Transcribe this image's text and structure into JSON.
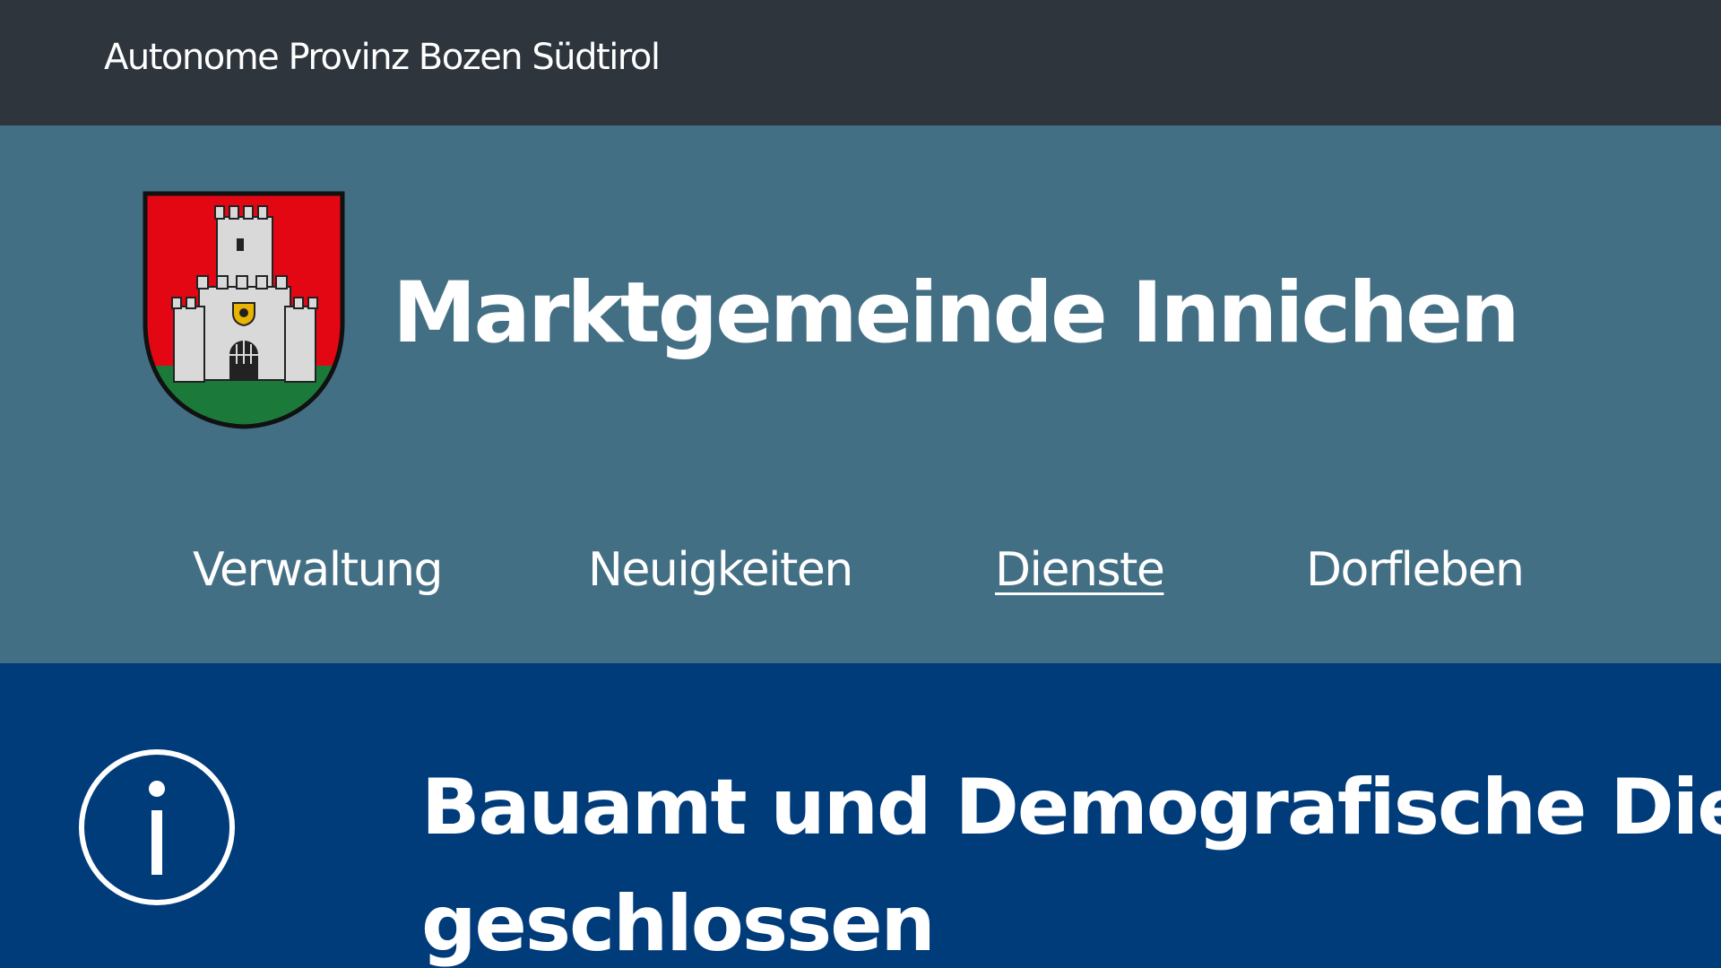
{
  "topbar": {
    "region_link": "Autonome Provinz Bozen Südtirol"
  },
  "header": {
    "logo_icon": "coat-of-arms-icon",
    "site_title": "Marktgemeinde Innichen",
    "nav": {
      "items": [
        {
          "label": "Verwaltung"
        },
        {
          "label": "Neuigkeiten"
        },
        {
          "label": "Dienste",
          "active": true
        },
        {
          "label": "Dorfleben"
        }
      ]
    }
  },
  "alert": {
    "icon": "info-icon",
    "title": "Bauamt und Demografische Dienste geschlossen"
  },
  "colors": {
    "topbar_bg": "#2e353d",
    "header_bg": "#436f85",
    "alert_bg": "#003b7a",
    "shield_red": "#e30613",
    "shield_green": "#1b7a3a"
  }
}
